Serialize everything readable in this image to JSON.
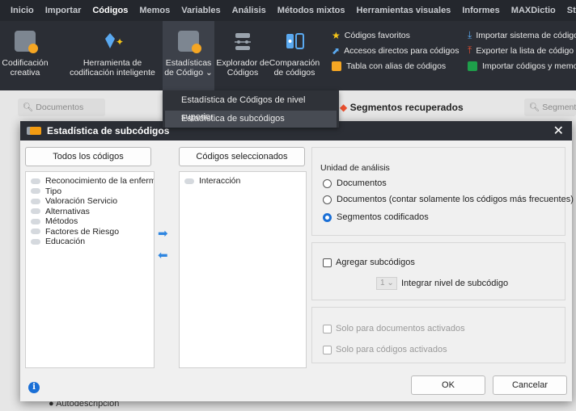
{
  "menubar": [
    "Inicio",
    "Importar",
    "Códigos",
    "Memos",
    "Variables",
    "Análisis",
    "Métodos mixtos",
    "Herramientas visuales",
    "Informes",
    "MAXDictio",
    "Stats"
  ],
  "ribbon": {
    "codificacion": [
      "Codificación",
      "creativa"
    ],
    "herramienta": [
      "Herramienta de",
      "codificación inteligente"
    ],
    "estadisticas": [
      "Estadísticas",
      "de Código ⌄"
    ],
    "explorador": [
      "Explorador de",
      "Códigos"
    ],
    "comparacion": [
      "Comparación",
      "de códigos"
    ],
    "col1": [
      "Códigos favoritos",
      "Accesos directos para códigos",
      "Tabla con alias de códigos"
    ],
    "col2": [
      "Importar sistema de código",
      "Exporter la lista de código",
      "Importar códigos y memo"
    ]
  },
  "dropdown": [
    "Estadística de Códigos de nivel superior",
    "Estadística de subcódigos"
  ],
  "background": {
    "doc_search": "Documentos",
    "segments_title": "Segmentos recuperados",
    "seg_search": "Segmentos",
    "bottom_row": "Autodescripción"
  },
  "dialog": {
    "title": "Estadística de subcódigos",
    "close": "✕",
    "all_codes_btn": "Todos los códigos",
    "selected_codes_btn": "Códigos seleccionados",
    "left_list": [
      "Reconocimiento de la enferme",
      "Tipo",
      "Valoración Servicio",
      "Alternativas",
      "Métodos",
      "Factores de Riesgo",
      "Educación"
    ],
    "right_list": [
      "Interacción"
    ],
    "unit_title": "Unidad de análisis",
    "options": [
      "Documentos",
      "Documentos (contar solamente los códigos más frecuentes)",
      "Segmentos codificados"
    ],
    "selected_option": 2,
    "aggregate": "Agregar subcódigos",
    "level_value": "1",
    "level_label": "Integrar nivel de subcódigo",
    "only_docs": "Solo para documentos activados",
    "only_codes": "Solo para códigos activados",
    "ok": "OK",
    "cancel": "Cancelar",
    "info": "i"
  },
  "colors": {
    "accent": "#1a6fd6",
    "titlebar": "#2b2e35",
    "arrow": "#2f86e0"
  }
}
